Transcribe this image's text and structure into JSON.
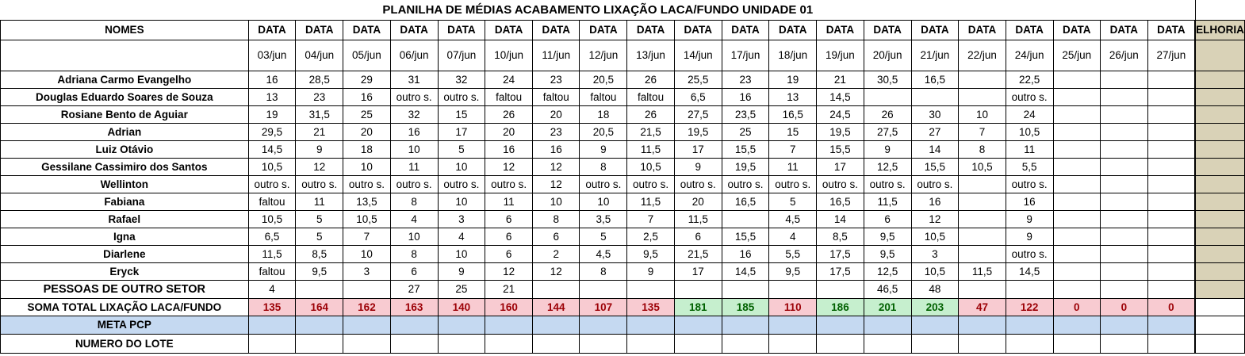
{
  "sheet": {
    "title": "PLANILHA DE MÉDIAS ACABAMENTO LIXAÇÃO LACA/FUNDO UNIDADE 01",
    "names_header": "NOMES",
    "data_header": "DATA",
    "melhoria_header": "ELHORIA",
    "dates": [
      "03/jun",
      "04/jun",
      "05/jun",
      "06/jun",
      "07/jun",
      "10/jun",
      "11/jun",
      "12/jun",
      "13/jun",
      "14/jun",
      "17/jun",
      "18/jun",
      "19/jun",
      "20/jun",
      "21/jun",
      "22/jun",
      "24/jun",
      "25/jun",
      "26/jun",
      "27/jun"
    ],
    "rows": [
      {
        "name": "Adriana Carmo Evangelho",
        "values": [
          "16",
          "28,5",
          "29",
          "31",
          "32",
          "24",
          "23",
          "20,5",
          "26",
          "25,5",
          "23",
          "19",
          "21",
          "30,5",
          "16,5",
          "",
          "22,5",
          "",
          "",
          ""
        ]
      },
      {
        "name": "Douglas Eduardo Soares de Souza",
        "values": [
          "13",
          "23",
          "16",
          "outro s.",
          "outro s.",
          "faltou",
          "faltou",
          "faltou",
          "faltou",
          "6,5",
          "16",
          "13",
          "14,5",
          "",
          "",
          "",
          "outro s.",
          "",
          "",
          ""
        ]
      },
      {
        "name": "Rosiane Bento de Aguiar",
        "values": [
          "19",
          "31,5",
          "25",
          "32",
          "15",
          "26",
          "20",
          "18",
          "26",
          "27,5",
          "23,5",
          "16,5",
          "24,5",
          "26",
          "30",
          "10",
          "24",
          "",
          "",
          ""
        ]
      },
      {
        "name": "Adrian",
        "values": [
          "29,5",
          "21",
          "20",
          "16",
          "17",
          "20",
          "23",
          "20,5",
          "21,5",
          "19,5",
          "25",
          "15",
          "19,5",
          "27,5",
          "27",
          "7",
          "10,5",
          "",
          "",
          ""
        ]
      },
      {
        "name": "Luiz Otávio",
        "values": [
          "14,5",
          "9",
          "18",
          "10",
          "5",
          "16",
          "16",
          "9",
          "11,5",
          "17",
          "15,5",
          "7",
          "15,5",
          "9",
          "14",
          "8",
          "11",
          "",
          "",
          ""
        ]
      },
      {
        "name": "Gessilane Cassimiro dos Santos",
        "values": [
          "10,5",
          "12",
          "10",
          "11",
          "10",
          "12",
          "12",
          "8",
          "10,5",
          "9",
          "19,5",
          "11",
          "17",
          "12,5",
          "15,5",
          "10,5",
          "5,5",
          "",
          "",
          ""
        ]
      },
      {
        "name": "Wellinton",
        "values": [
          "outro s.",
          "outro s.",
          "outro s.",
          "outro s.",
          "outro s.",
          "outro s.",
          "12",
          "outro s.",
          "outro s.",
          "outro s.",
          "outro s.",
          "outro s.",
          "outro s.",
          "outro s.",
          "outro s.",
          "",
          "outro s.",
          "",
          "",
          ""
        ]
      },
      {
        "name": "Fabiana",
        "values": [
          "faltou",
          "11",
          "13,5",
          "8",
          "10",
          "11",
          "10",
          "10",
          "11,5",
          "20",
          "16,5",
          "5",
          "16,5",
          "11,5",
          "16",
          "",
          "16",
          "",
          "",
          ""
        ]
      },
      {
        "name": "Rafael",
        "values": [
          "10,5",
          "5",
          "10,5",
          "4",
          "3",
          "6",
          "8",
          "3,5",
          "7",
          "11,5",
          "",
          "4,5",
          "14",
          "6",
          "12",
          "",
          "9",
          "",
          "",
          ""
        ]
      },
      {
        "name": "Igna",
        "values": [
          "6,5",
          "5",
          "7",
          "10",
          "4",
          "6",
          "6",
          "5",
          "2,5",
          "6",
          "15,5",
          "4",
          "8,5",
          "9,5",
          "10,5",
          "",
          "9",
          "",
          "",
          ""
        ]
      },
      {
        "name": "Diarlene",
        "values": [
          "11,5",
          "8,5",
          "10",
          "8",
          "10",
          "6",
          "2",
          "4,5",
          "9,5",
          "21,5",
          "16",
          "5,5",
          "17,5",
          "9,5",
          "3",
          "",
          "outro s.",
          "",
          "",
          ""
        ]
      },
      {
        "name": "Eryck",
        "values": [
          "faltou",
          "9,5",
          "3",
          "6",
          "9",
          "12",
          "12",
          "8",
          "9",
          "17",
          "14,5",
          "9,5",
          "17,5",
          "12,5",
          "10,5",
          "11,5",
          "14,5",
          "",
          "",
          ""
        ]
      },
      {
        "name": "PESSOAS DE OUTRO SETOR",
        "values": [
          "4",
          "",
          "",
          "27",
          "25",
          "21",
          "",
          "",
          "",
          "",
          "",
          "",
          "",
          "46,5",
          "48",
          "",
          "",
          "",
          "",
          ""
        ]
      }
    ],
    "soma": {
      "label": "SOMA TOTAL LIXAÇÃO LACA/FUNDO",
      "values": [
        "135",
        "164",
        "162",
        "163",
        "140",
        "160",
        "144",
        "107",
        "135",
        "181",
        "185",
        "110",
        "186",
        "201",
        "203",
        "47",
        "122",
        "0",
        "0",
        "0"
      ],
      "status": [
        "red",
        "red",
        "red",
        "red",
        "red",
        "red",
        "red",
        "red",
        "red",
        "green",
        "green",
        "red",
        "green",
        "green",
        "green",
        "red",
        "red",
        "red",
        "red",
        "red"
      ],
      "colors": {
        "red_bg": "#f8cbd1",
        "red_text": "#9c0006",
        "green_bg": "#c6efce",
        "green_text": "#006100"
      }
    },
    "meta_label": "META PCP",
    "lote_label": "NUMERO DO LOTE"
  }
}
